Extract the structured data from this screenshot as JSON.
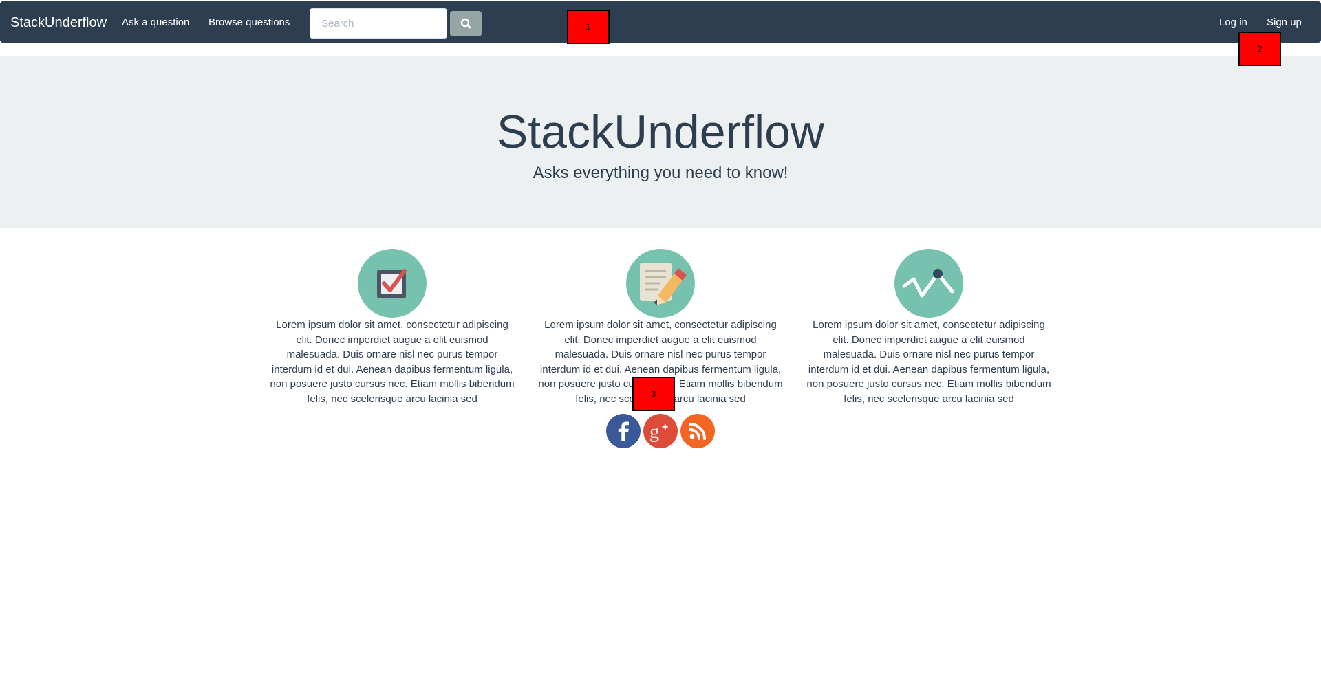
{
  "navbar": {
    "brand": "StackUnderflow",
    "links": [
      "Ask a question",
      "Browse questions"
    ],
    "search_placeholder": "Search",
    "search_value": "",
    "right_links": [
      "Log in",
      "Sign up"
    ]
  },
  "hero": {
    "title": "StackUnderflow",
    "subtitle": "Asks everything you need to know!"
  },
  "features": [
    {
      "icon": "checkbox-icon",
      "text": "Lorem ipsum dolor sit amet, consectetur adipiscing elit. Donec imperdiet augue a elit euismod malesuada. Duis ornare nisl nec purus tempor interdum id et dui. Aenean dapibus fermentum ligula, non posuere justo cursus nec. Etiam mollis bibendum felis, nec scelerisque arcu lacinia sed"
    },
    {
      "icon": "document-pencil-icon",
      "text": "Lorem ipsum dolor sit amet, consectetur adipiscing elit. Donec imperdiet augue a elit euismod malesuada. Duis ornare nisl nec purus tempor interdum id et dui. Aenean dapibus fermentum ligula, non posuere justo cursus nec. Etiam mollis bibendum felis, nec scelerisque arcu lacinia sed"
    },
    {
      "icon": "line-chart-icon",
      "text": "Lorem ipsum dolor sit amet, consectetur adipiscing elit. Donec imperdiet augue a elit euismod malesuada. Duis ornare nisl nec purus tempor interdum id et dui. Aenean dapibus fermentum ligula, non posuere justo cursus nec. Etiam mollis bibendum felis, nec scelerisque arcu lacinia sed"
    }
  ],
  "social": [
    {
      "icon": "facebook-icon",
      "color": "#3b5998"
    },
    {
      "icon": "google-plus-icon",
      "color": "#dd4b39"
    },
    {
      "icon": "rss-icon",
      "color": "#f26522"
    }
  ],
  "markers": [
    "1",
    "2",
    "3"
  ],
  "colors": {
    "navbar": "#2c3e50",
    "hero_bg": "#ecf0f1",
    "icon_bg": "#76c2af",
    "marker": "#ff0000"
  }
}
